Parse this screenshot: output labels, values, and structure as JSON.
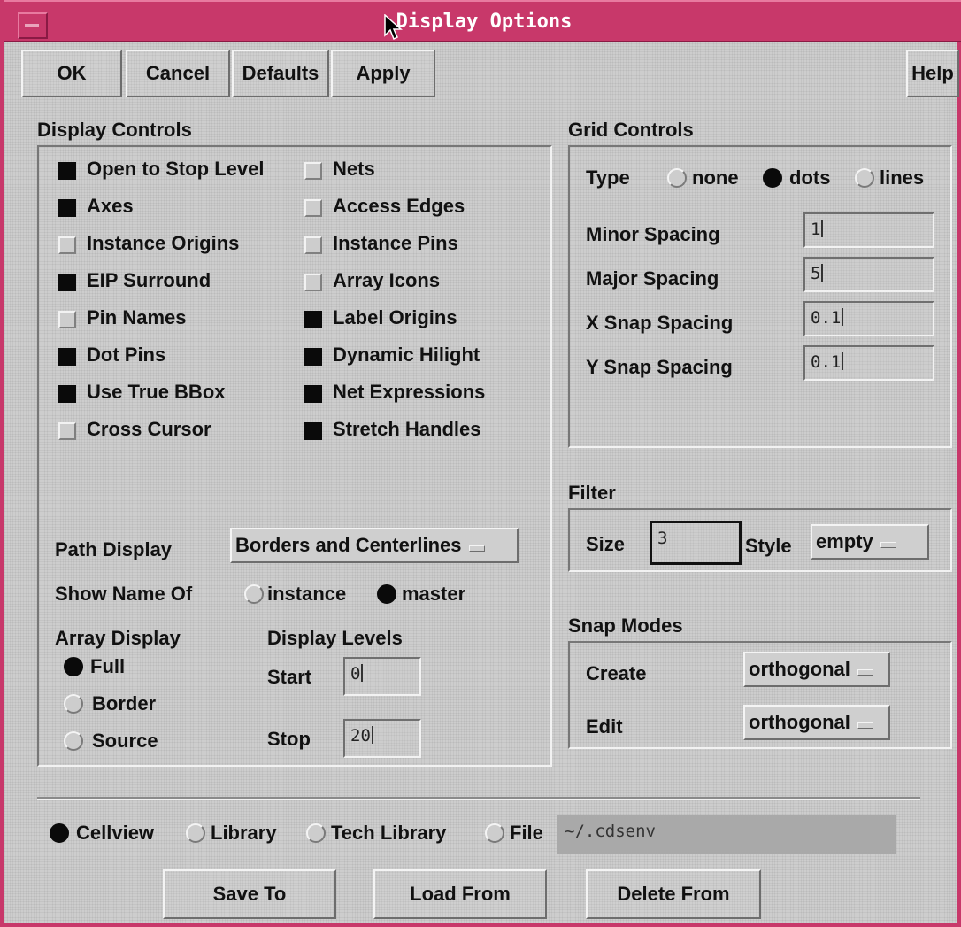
{
  "window": {
    "title": "Display Options"
  },
  "toolbar": {
    "ok": "OK",
    "cancel": "Cancel",
    "defaults": "Defaults",
    "apply": "Apply",
    "help": "Help"
  },
  "display_controls": {
    "heading": "Display Controls",
    "left": [
      {
        "label": "Open to Stop Level",
        "checked": true
      },
      {
        "label": "Axes",
        "checked": true
      },
      {
        "label": "Instance Origins",
        "checked": false
      },
      {
        "label": "EIP Surround",
        "checked": true
      },
      {
        "label": "Pin Names",
        "checked": false
      },
      {
        "label": "Dot Pins",
        "checked": true
      },
      {
        "label": "Use True BBox",
        "checked": true
      },
      {
        "label": "Cross Cursor",
        "checked": false
      }
    ],
    "right": [
      {
        "label": "Nets",
        "checked": false
      },
      {
        "label": "Access Edges",
        "checked": false
      },
      {
        "label": "Instance Pins",
        "checked": false
      },
      {
        "label": "Array Icons",
        "checked": false
      },
      {
        "label": "Label Origins",
        "checked": true
      },
      {
        "label": "Dynamic Hilight",
        "checked": true
      },
      {
        "label": "Net Expressions",
        "checked": true
      },
      {
        "label": "Stretch Handles",
        "checked": true
      }
    ],
    "path_display": {
      "label": "Path Display",
      "value": "Borders and Centerlines"
    },
    "show_name_of": {
      "label": "Show Name Of",
      "options": [
        "instance",
        "master"
      ],
      "selected": "master"
    },
    "array_display": {
      "label": "Array Display",
      "options": [
        "Full",
        "Border",
        "Source"
      ],
      "selected": "Full"
    },
    "display_levels": {
      "label": "Display Levels",
      "start_label": "Start",
      "start_value": "0",
      "stop_label": "Stop",
      "stop_value": "20"
    }
  },
  "grid_controls": {
    "heading": "Grid Controls",
    "type_label": "Type",
    "type_options": [
      "none",
      "dots",
      "lines"
    ],
    "type_selected": "dots",
    "minor_label": "Minor Spacing",
    "minor_value": "1",
    "major_label": "Major Spacing",
    "major_value": "5",
    "xsnap_label": "X Snap Spacing",
    "xsnap_value": "0.1",
    "ysnap_label": "Y Snap Spacing",
    "ysnap_value": "0.1"
  },
  "filter": {
    "heading": "Filter",
    "size_label": "Size",
    "size_value": "3",
    "style_label": "Style",
    "style_value": "empty"
  },
  "snap_modes": {
    "heading": "Snap Modes",
    "create_label": "Create",
    "create_value": "orthogonal",
    "edit_label": "Edit",
    "edit_value": "orthogonal"
  },
  "bottom": {
    "options": [
      "Cellview",
      "Library",
      "Tech Library",
      "File"
    ],
    "selected": "Cellview",
    "file_value": "~/.cdsenv",
    "save_to": "Save To",
    "load_from": "Load From",
    "delete_from": "Delete From"
  },
  "colors": {
    "titlebar": "#c8386a",
    "dialog_bg": "#cdcdcd"
  }
}
